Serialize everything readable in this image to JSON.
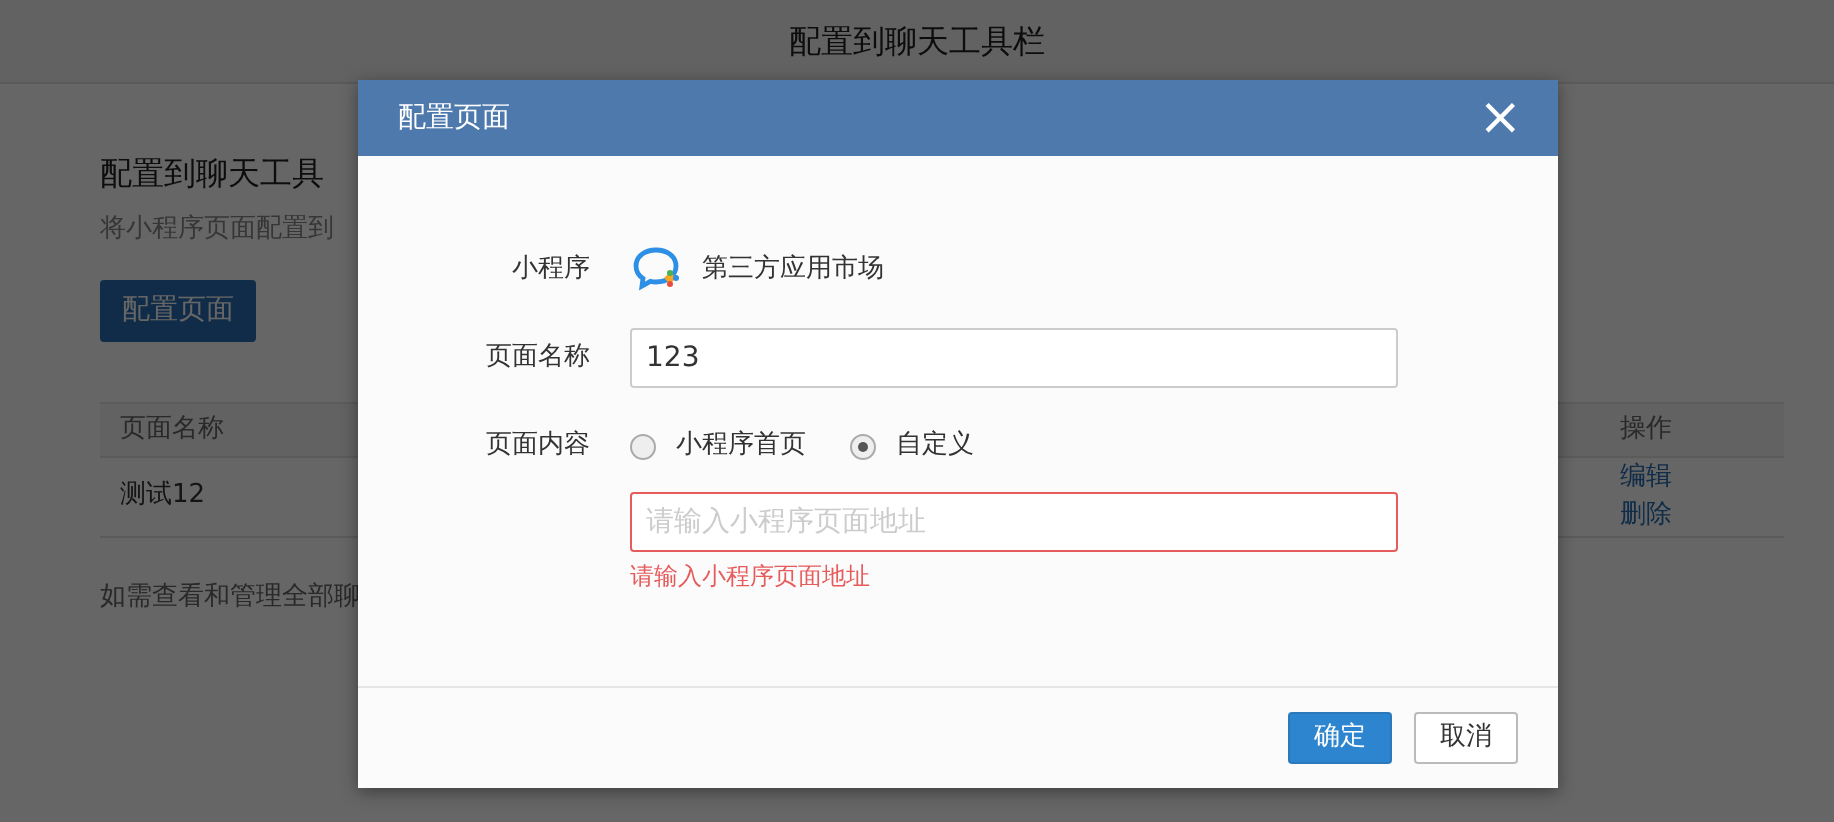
{
  "page": {
    "title": "配置到聊天工具栏",
    "section_title": "配置到聊天工具",
    "section_desc": "将小程序页面配置到",
    "config_button": "配置页面",
    "table": {
      "columns": [
        "页面名称",
        "操作"
      ],
      "rows": [
        {
          "name": "测试12",
          "actions": [
            "编辑",
            "删除"
          ]
        }
      ]
    },
    "footer_note": "如需查看和管理全部聊"
  },
  "dialog": {
    "title": "配置页面",
    "close": "×",
    "fields": [
      {
        "kind": "app",
        "label": "小程序",
        "value": "第三方应用市场"
      },
      {
        "kind": "text",
        "label": "页面名称",
        "value": "123"
      },
      {
        "kind": "radio",
        "label": "页面内容",
        "options": [
          {
            "label": "小程序首页",
            "selected": false
          },
          {
            "label": "自定义",
            "selected": true
          }
        ],
        "input": {
          "placeholder": "请输入小程序页面地址",
          "invalid": true,
          "error": "请输入小程序页面地址"
        }
      }
    ],
    "buttons": [
      {
        "label": "确定",
        "primary": true
      },
      {
        "label": "取消",
        "primary": false
      }
    ]
  }
}
